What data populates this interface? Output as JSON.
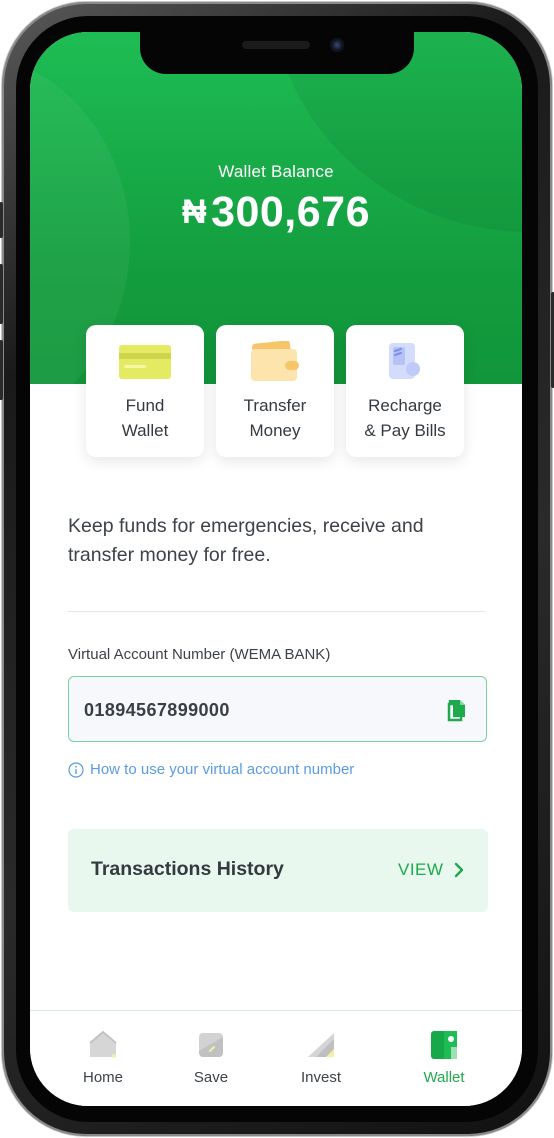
{
  "balance": {
    "label": "Wallet Balance",
    "currency": "₦",
    "amount": "300,676"
  },
  "actions": [
    {
      "label": "Fund\nWallet",
      "icon": "card-icon"
    },
    {
      "label": "Transfer\nMoney",
      "icon": "wallet-icon"
    },
    {
      "label": "Recharge\n& Pay Bills",
      "icon": "receipt-icon"
    }
  ],
  "description": "Keep funds for emergencies, receive and transfer money for free.",
  "virtual_account": {
    "label": "Virtual Account Number (WEMA BANK)",
    "number": "01894567899000",
    "help_text": "How to use your virtual account number"
  },
  "transactions": {
    "title": "Transactions History",
    "view_label": "VIEW"
  },
  "nav": {
    "items": [
      {
        "label": "Home",
        "icon": "home-icon",
        "active": false
      },
      {
        "label": "Save",
        "icon": "save-icon",
        "active": false
      },
      {
        "label": "Invest",
        "icon": "invest-icon",
        "active": false
      },
      {
        "label": "Wallet",
        "icon": "wallet-icon",
        "active": true
      }
    ]
  },
  "colors": {
    "primary_green": "#1ebd54",
    "link_blue": "#5a9be6",
    "accent_green": "#1ea94c"
  }
}
